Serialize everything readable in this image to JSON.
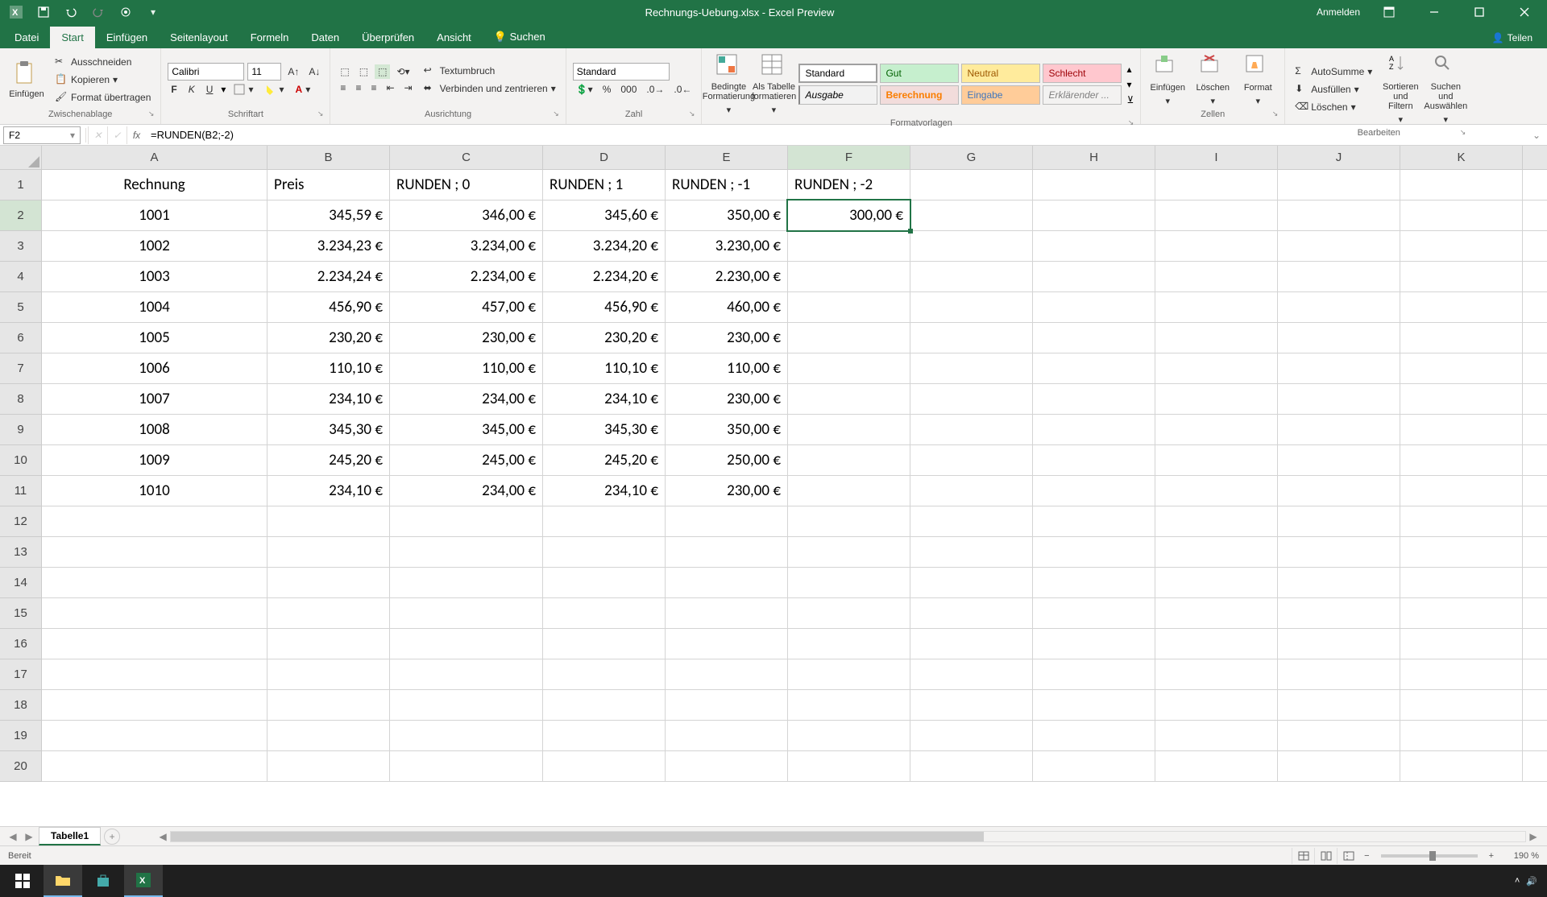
{
  "titlebar": {
    "title": "Rechnungs-Uebung.xlsx - Excel Preview",
    "anmelden": "Anmelden"
  },
  "tabs": {
    "datei": "Datei",
    "start": "Start",
    "einfuegen": "Einfügen",
    "seitenlayout": "Seitenlayout",
    "formeln": "Formeln",
    "daten": "Daten",
    "ueberpruefen": "Überprüfen",
    "ansicht": "Ansicht",
    "suchen": "Suchen",
    "teilen": "Teilen"
  },
  "ribbon": {
    "zwischenablage": {
      "label": "Zwischenablage",
      "einfuegen": "Einfügen",
      "ausschneiden": "Ausschneiden",
      "kopieren": "Kopieren",
      "format_uebertragen": "Format übertragen"
    },
    "schriftart": {
      "label": "Schriftart",
      "font": "Calibri",
      "size": "11"
    },
    "ausrichtung": {
      "label": "Ausrichtung",
      "textumbruch": "Textumbruch",
      "verbinden": "Verbinden und zentrieren"
    },
    "zahl": {
      "label": "Zahl",
      "format": "Standard"
    },
    "formatvorlagen": {
      "label": "Formatvorlagen",
      "bedingte": "Bedingte Formatierung",
      "als_tabelle": "Als Tabelle formatieren",
      "standard": "Standard",
      "gut": "Gut",
      "neutral": "Neutral",
      "schlecht": "Schlecht",
      "ausgabe": "Ausgabe",
      "berechnung": "Berechnung",
      "eingabe": "Eingabe",
      "erklaerender": "Erklärender ..."
    },
    "zellen": {
      "label": "Zellen",
      "einfuegen": "Einfügen",
      "loeschen": "Löschen",
      "format": "Format"
    },
    "bearbeiten": {
      "label": "Bearbeiten",
      "autosumme": "AutoSumme",
      "ausfuellen": "Ausfüllen",
      "loeschen": "Löschen",
      "sortieren": "Sortieren und Filtern",
      "suchen": "Suchen und Auswählen"
    }
  },
  "formula_bar": {
    "name_box": "F2",
    "formula": "=RUNDEN(B2;-2)"
  },
  "grid": {
    "cols": [
      "A",
      "B",
      "C",
      "D",
      "E",
      "F",
      "G",
      "H",
      "I",
      "J",
      "K"
    ],
    "rows": [
      "1",
      "2",
      "3",
      "4",
      "5",
      "6",
      "7",
      "8",
      "9",
      "10",
      "11",
      "12",
      "13",
      "14",
      "15",
      "16",
      "17",
      "18",
      "19",
      "20"
    ],
    "headers": {
      "A": "Rechnung",
      "B": "Preis",
      "C": "RUNDEN ; 0",
      "D": "RUNDEN ; 1",
      "E": "RUNDEN ; -1",
      "F": "RUNDEN ; -2"
    },
    "data": [
      {
        "A": "1001",
        "B": "345,59 €",
        "C": "346,00 €",
        "D": "345,60 €",
        "E": "350,00 €",
        "F": "300,00 €"
      },
      {
        "A": "1002",
        "B": "3.234,23 €",
        "C": "3.234,00 €",
        "D": "3.234,20 €",
        "E": "3.230,00 €",
        "F": ""
      },
      {
        "A": "1003",
        "B": "2.234,24 €",
        "C": "2.234,00 €",
        "D": "2.234,20 €",
        "E": "2.230,00 €",
        "F": ""
      },
      {
        "A": "1004",
        "B": "456,90 €",
        "C": "457,00 €",
        "D": "456,90 €",
        "E": "460,00 €",
        "F": ""
      },
      {
        "A": "1005",
        "B": "230,20 €",
        "C": "230,00 €",
        "D": "230,20 €",
        "E": "230,00 €",
        "F": ""
      },
      {
        "A": "1006",
        "B": "110,10 €",
        "C": "110,00 €",
        "D": "110,10 €",
        "E": "110,00 €",
        "F": ""
      },
      {
        "A": "1007",
        "B": "234,10 €",
        "C": "234,00 €",
        "D": "234,10 €",
        "E": "230,00 €",
        "F": ""
      },
      {
        "A": "1008",
        "B": "345,30 €",
        "C": "345,00 €",
        "D": "345,30 €",
        "E": "350,00 €",
        "F": ""
      },
      {
        "A": "1009",
        "B": "245,20 €",
        "C": "245,00 €",
        "D": "245,20 €",
        "E": "250,00 €",
        "F": ""
      },
      {
        "A": "1010",
        "B": "234,10 €",
        "C": "234,00 €",
        "D": "234,10 €",
        "E": "230,00 €",
        "F": ""
      }
    ],
    "active": "F2"
  },
  "chart_data": {
    "type": "table",
    "title": "Rechnungs-Uebung",
    "columns": [
      "Rechnung",
      "Preis",
      "RUNDEN ; 0",
      "RUNDEN ; 1",
      "RUNDEN ; -1",
      "RUNDEN ; -2"
    ],
    "rows": [
      [
        1001,
        345.59,
        346.0,
        345.6,
        350.0,
        300.0
      ],
      [
        1002,
        3234.23,
        3234.0,
        3234.2,
        3230.0,
        null
      ],
      [
        1003,
        2234.24,
        2234.0,
        2234.2,
        2230.0,
        null
      ],
      [
        1004,
        456.9,
        457.0,
        456.9,
        460.0,
        null
      ],
      [
        1005,
        230.2,
        230.0,
        230.2,
        230.0,
        null
      ],
      [
        1006,
        110.1,
        110.0,
        110.1,
        110.0,
        null
      ],
      [
        1007,
        234.1,
        234.0,
        234.1,
        230.0,
        null
      ],
      [
        1008,
        345.3,
        345.0,
        345.3,
        350.0,
        null
      ],
      [
        1009,
        245.2,
        245.0,
        245.2,
        250.0,
        null
      ],
      [
        1010,
        234.1,
        234.0,
        234.1,
        230.0,
        null
      ]
    ]
  },
  "sheet_tabs": {
    "tab1": "Tabelle1"
  },
  "statusbar": {
    "bereit": "Bereit",
    "zoom": "190 %"
  }
}
